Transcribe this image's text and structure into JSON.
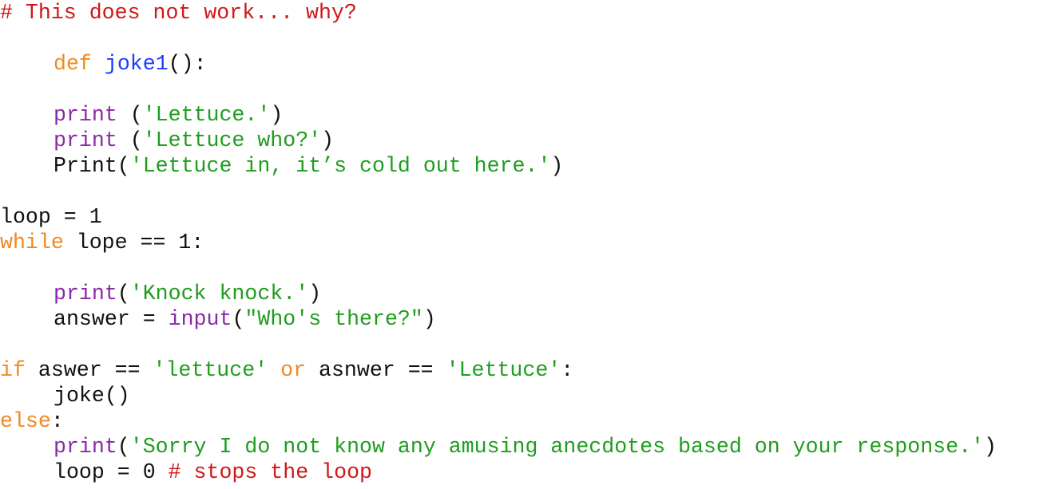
{
  "code": {
    "lines": [
      {
        "tokens": [
          {
            "text": "# This does not work... why?"
          }
        ]
      },
      {
        "tokens": []
      },
      {
        "tokens": [
          {
            "text": "def"
          },
          {
            "text": " "
          },
          {
            "text": "joke1"
          },
          {
            "text": "():"
          }
        ]
      },
      {
        "tokens": []
      },
      {
        "tokens": [
          {
            "text": "print"
          },
          {
            "text": " ("
          },
          {
            "text": "'Lettuce.'"
          },
          {
            "text": ")"
          }
        ]
      },
      {
        "tokens": [
          {
            "text": "print"
          },
          {
            "text": " ("
          },
          {
            "text": "'Lettuce who?'"
          },
          {
            "text": ")"
          }
        ]
      },
      {
        "tokens": [
          {
            "text": "Print("
          },
          {
            "text": "'Lettuce in, it’s cold out here.'"
          },
          {
            "text": ")"
          }
        ]
      },
      {
        "tokens": []
      },
      {
        "tokens": [
          {
            "text": "loop = 1"
          }
        ]
      },
      {
        "tokens": [
          {
            "text": "while"
          },
          {
            "text": " lope == 1:"
          }
        ]
      },
      {
        "tokens": []
      },
      {
        "tokens": [
          {
            "text": "print"
          },
          {
            "text": "("
          },
          {
            "text": "'Knock knock.'"
          },
          {
            "text": ")"
          }
        ]
      },
      {
        "tokens": [
          {
            "text": "answer = "
          },
          {
            "text": "input"
          },
          {
            "text": "("
          },
          {
            "text": "\"Who's there?\""
          },
          {
            "text": ")"
          }
        ]
      },
      {
        "tokens": []
      },
      {
        "tokens": [
          {
            "text": "if"
          },
          {
            "text": " aswer == "
          },
          {
            "text": "'lettuce'"
          },
          {
            "text": " "
          },
          {
            "text": "or"
          },
          {
            "text": " asnwer == "
          },
          {
            "text": "'Lettuce'"
          },
          {
            "text": ":"
          }
        ]
      },
      {
        "tokens": [
          {
            "text": "joke()"
          }
        ]
      },
      {
        "tokens": [
          {
            "text": "else"
          },
          {
            "text": ":"
          }
        ]
      },
      {
        "tokens": [
          {
            "text": "print"
          },
          {
            "text": "("
          },
          {
            "text": "'Sorry I do not know any amusing anecdotes based on your response.'"
          },
          {
            "text": ")"
          }
        ]
      },
      {
        "tokens": [
          {
            "text": "loop = 0 "
          },
          {
            "text": "# stops the loop"
          }
        ]
      }
    ]
  },
  "colors": {
    "keyword": "#f08a24",
    "string": "#1f9d1f",
    "comment": "#d01818",
    "function_name": "#1d3cff",
    "builtin": "#8a2aa6",
    "default": "#111111",
    "background": "#ffffff"
  }
}
